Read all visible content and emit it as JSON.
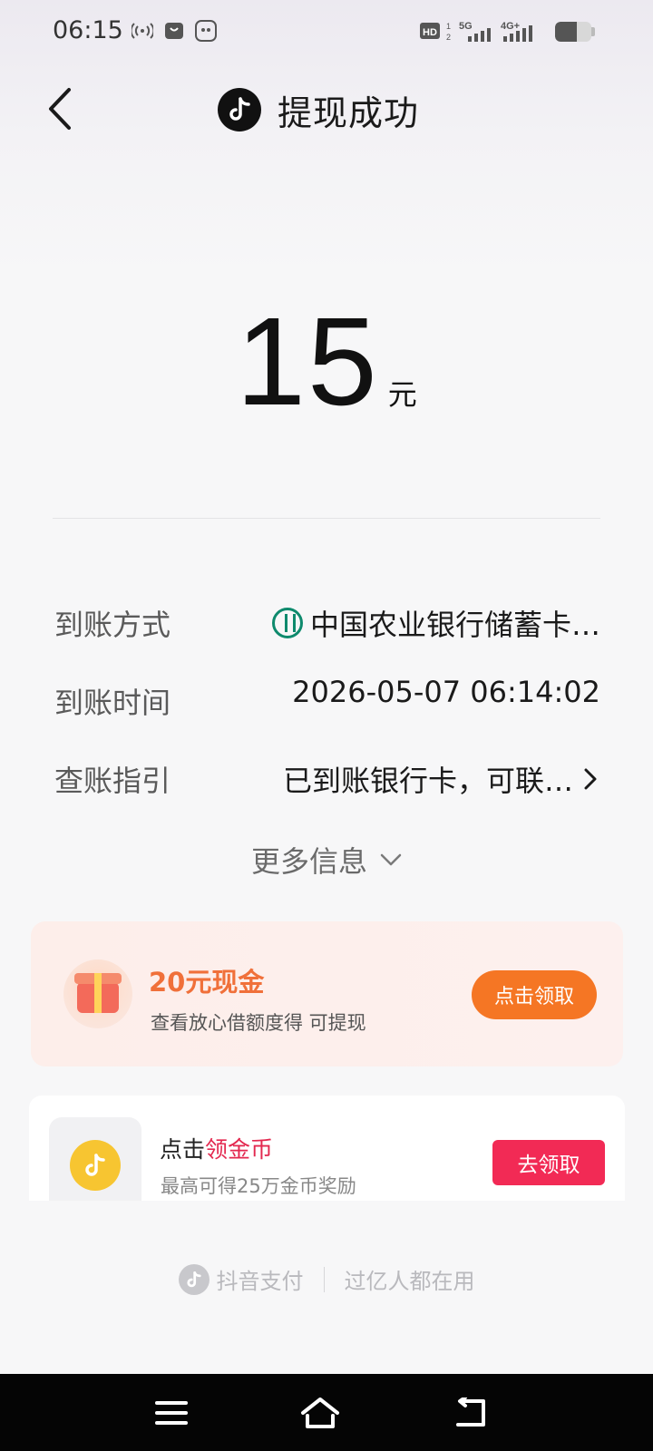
{
  "status_bar": {
    "time": "06:15",
    "icons": [
      "hotspot-icon",
      "shopping-bag-icon",
      "app-notification-icon",
      "hd-icon",
      "signal-5g-icon",
      "signal-4g-icon",
      "battery-icon"
    ],
    "hd_label": "HD",
    "net1": "5G",
    "net2": "4G+"
  },
  "header": {
    "title": "提现成功",
    "back_icon": "chevron-left-icon",
    "logo_icon": "douyin-logo-icon"
  },
  "amount": {
    "value": "15",
    "unit": "元"
  },
  "details": {
    "method_label": "到账方式",
    "method_value": "中国农业银行储蓄卡…",
    "time_label": "到账时间",
    "time_value": "2026-05-07 06:14:02",
    "guide_label": "查账指引",
    "guide_value": "已到账银行卡，可联…"
  },
  "more": {
    "label": "更多信息"
  },
  "promo": {
    "title": "20元现金",
    "subtitle": "查看放心借额度得 可提现",
    "button": "点击领取",
    "accent": "#f57624"
  },
  "coin": {
    "title_prefix": "点击",
    "title_highlight": "领金币",
    "subtitle": "最高可得25万金币奖励",
    "button": "去领取",
    "accent": "#f22a55"
  },
  "footer": {
    "brand": "抖音支付",
    "slogan": "过亿人都在用"
  },
  "navbar": {
    "menu_icon": "menu-icon",
    "home_icon": "home-icon",
    "back_icon": "return-icon"
  }
}
